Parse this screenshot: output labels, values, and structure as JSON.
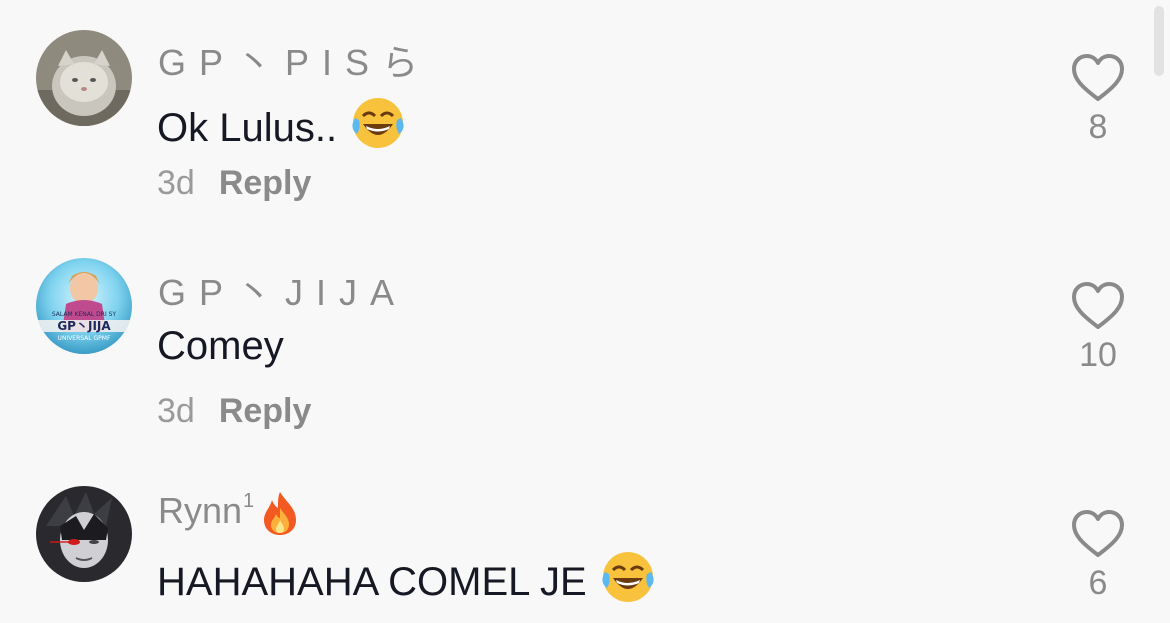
{
  "comments": [
    {
      "username": "GP丶PISら",
      "text": "Ok Lulus..",
      "emoji": "joy-emoji",
      "time": "3d",
      "reply_label": "Reply",
      "likes": "8"
    },
    {
      "username": "GP丶JIJA",
      "text": "Comey",
      "time": "3d",
      "reply_label": "Reply",
      "likes": "10",
      "avatar_text": {
        "top": "SALAM KENAL DRI SY",
        "middle": "GP丶JIJA",
        "bottom": "UNIVERSAL GPMF"
      }
    },
    {
      "username": "Rynn",
      "username_sup": "1",
      "username_emoji": "fire-emoji",
      "text": "HAHAHAHA COMEL JE",
      "emoji": "joy-emoji",
      "likes": "6"
    }
  ],
  "colors": {
    "background": "#f8f8f8",
    "text": "#161823",
    "muted": "#8a8a8a"
  }
}
